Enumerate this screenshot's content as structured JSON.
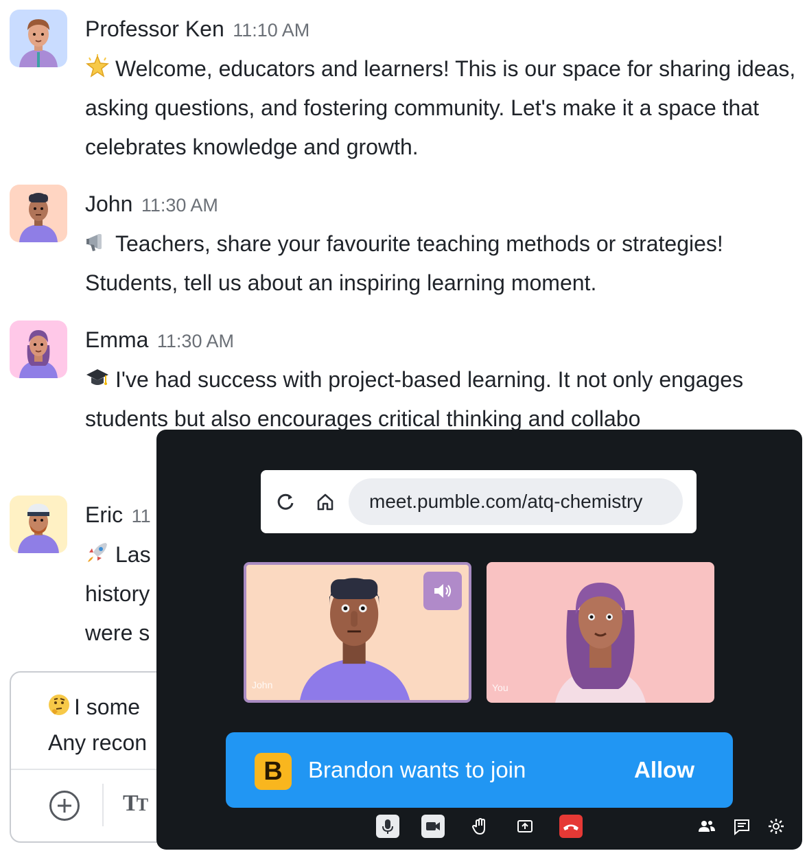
{
  "messages": [
    {
      "author": "Professor Ken",
      "time": "11:10 AM",
      "emoji": "star-emoji",
      "text": "Welcome, educators and learners! This is our space for sharing ideas, asking questions, and fostering community. Let's make it a space that celebrates knowledge and growth.",
      "avatar_bg": "#c9dcff"
    },
    {
      "author": "John",
      "time": "11:30 AM",
      "emoji": "megaphone-emoji",
      "text": "Teachers, share your favourite teaching methods or strategies! Students, tell us about an inspiring learning moment.",
      "avatar_bg": "#ffd5c2"
    },
    {
      "author": "Emma",
      "time": "11:30 AM",
      "emoji": "graduation-cap-emoji",
      "text": "I've had success with project-based learning. It not only engages students but also encourages critical thinking and collabo",
      "avatar_bg": "#ffc8e8"
    },
    {
      "author": "Eric",
      "time": "11",
      "emoji": "rocket-emoji",
      "text_lines": [
        "Las",
        "history",
        "were s"
      ],
      "avatar_bg": "#fff1c4"
    }
  ],
  "composer": {
    "emoji": "thinking-face-emoji",
    "lines": [
      "I some",
      "Any recon"
    ],
    "format_label_big": "T",
    "format_label_small": "T"
  },
  "meeting": {
    "url": "meet.pumble.com/atq-chemistry",
    "tiles": [
      {
        "name": "John",
        "bg": "#fbd9c1",
        "active_speaker": true
      },
      {
        "name": "You",
        "bg": "#f9c2c2",
        "active_speaker": false
      }
    ],
    "join_request": {
      "badge": "B",
      "text": "Brandon wants to join",
      "action": "Allow"
    },
    "controls": [
      "mic-icon",
      "camera-icon",
      "raise-hand-icon",
      "share-screen-icon",
      "hang-up-icon",
      "participants-icon",
      "chat-icon",
      "settings-icon"
    ]
  },
  "colors": {
    "meeting_bg": "#15191d",
    "banner": "#2196f3",
    "hangup": "#e53935",
    "accent_purple": "#b08ac9"
  }
}
